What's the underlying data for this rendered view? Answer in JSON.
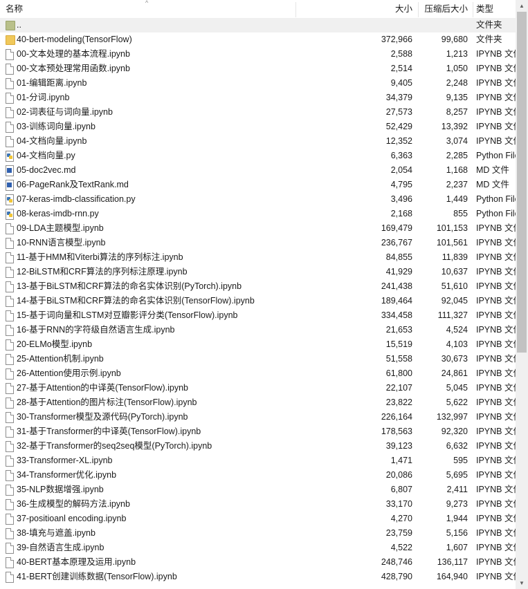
{
  "header": {
    "name_label": "名称",
    "size_label": "大小",
    "compressed_label": "压缩后大小",
    "type_label": "类型",
    "sort_indicator": "^"
  },
  "scrollbar": {
    "up_arrow": "▲",
    "down_arrow": "▼"
  },
  "rows": [
    {
      "name": "..",
      "size": "",
      "compressed": "",
      "type": "文件夹",
      "icon": "folder-up-icon"
    },
    {
      "name": "40-bert-modeling(TensorFlow)",
      "size": "372,966",
      "compressed": "99,680",
      "type": "文件夹",
      "icon": "folder-icon"
    },
    {
      "name": "00-文本处理的基本流程.ipynb",
      "size": "2,588",
      "compressed": "1,213",
      "type": "IPYNB 文件",
      "icon": "file-icon"
    },
    {
      "name": "00-文本预处理常用函数.ipynb",
      "size": "2,514",
      "compressed": "1,050",
      "type": "IPYNB 文件",
      "icon": "file-icon"
    },
    {
      "name": "01-编辑距离.ipynb",
      "size": "9,405",
      "compressed": "2,248",
      "type": "IPYNB 文件",
      "icon": "file-icon"
    },
    {
      "name": "01-分词.ipynb",
      "size": "34,379",
      "compressed": "9,135",
      "type": "IPYNB 文件",
      "icon": "file-icon"
    },
    {
      "name": "02-词表征与词向量.ipynb",
      "size": "27,573",
      "compressed": "8,257",
      "type": "IPYNB 文件",
      "icon": "file-icon"
    },
    {
      "name": "03-训练词向量.ipynb",
      "size": "52,429",
      "compressed": "13,392",
      "type": "IPYNB 文件",
      "icon": "file-icon"
    },
    {
      "name": "04-文档向量.ipynb",
      "size": "12,352",
      "compressed": "3,074",
      "type": "IPYNB 文件",
      "icon": "file-icon"
    },
    {
      "name": "04-文档向量.py",
      "size": "6,363",
      "compressed": "2,285",
      "type": "Python File",
      "icon": "python-file-icon"
    },
    {
      "name": "05-doc2vec.md",
      "size": "2,054",
      "compressed": "1,168",
      "type": "MD 文件",
      "icon": "markdown-file-icon"
    },
    {
      "name": "06-PageRank及TextRank.md",
      "size": "4,795",
      "compressed": "2,237",
      "type": "MD 文件",
      "icon": "markdown-file-icon"
    },
    {
      "name": "07-keras-imdb-classification.py",
      "size": "3,496",
      "compressed": "1,449",
      "type": "Python File",
      "icon": "python-file-icon"
    },
    {
      "name": "08-keras-imdb-rnn.py",
      "size": "2,168",
      "compressed": "855",
      "type": "Python File",
      "icon": "python-file-icon"
    },
    {
      "name": "09-LDA主题模型.ipynb",
      "size": "169,479",
      "compressed": "101,153",
      "type": "IPYNB 文件",
      "icon": "file-icon"
    },
    {
      "name": "10-RNN语言模型.ipynb",
      "size": "236,767",
      "compressed": "101,561",
      "type": "IPYNB 文件",
      "icon": "file-icon"
    },
    {
      "name": "11-基于HMM和Viterbi算法的序列标注.ipynb",
      "size": "84,855",
      "compressed": "11,839",
      "type": "IPYNB 文件",
      "icon": "file-icon"
    },
    {
      "name": "12-BiLSTM和CRF算法的序列标注原理.ipynb",
      "size": "41,929",
      "compressed": "10,637",
      "type": "IPYNB 文件",
      "icon": "file-icon"
    },
    {
      "name": "13-基于BiLSTM和CRF算法的命名实体识别(PyTorch).ipynb",
      "size": "241,438",
      "compressed": "51,610",
      "type": "IPYNB 文件",
      "icon": "file-icon"
    },
    {
      "name": "14-基于BiLSTM和CRF算法的命名实体识别(TensorFlow).ipynb",
      "size": "189,464",
      "compressed": "92,045",
      "type": "IPYNB 文件",
      "icon": "file-icon"
    },
    {
      "name": "15-基于词向量和LSTM对豆瓣影评分类(TensorFlow).ipynb",
      "size": "334,458",
      "compressed": "111,327",
      "type": "IPYNB 文件",
      "icon": "file-icon"
    },
    {
      "name": "16-基于RNN的字符级自然语言生成.ipynb",
      "size": "21,653",
      "compressed": "4,524",
      "type": "IPYNB 文件",
      "icon": "file-icon"
    },
    {
      "name": "20-ELMo模型.ipynb",
      "size": "15,519",
      "compressed": "4,103",
      "type": "IPYNB 文件",
      "icon": "file-icon"
    },
    {
      "name": "25-Attention机制.ipynb",
      "size": "51,558",
      "compressed": "30,673",
      "type": "IPYNB 文件",
      "icon": "file-icon"
    },
    {
      "name": "26-Attention使用示例.ipynb",
      "size": "61,800",
      "compressed": "24,861",
      "type": "IPYNB 文件",
      "icon": "file-icon"
    },
    {
      "name": "27-基于Attention的中译英(TensorFlow).ipynb",
      "size": "22,107",
      "compressed": "5,045",
      "type": "IPYNB 文件",
      "icon": "file-icon"
    },
    {
      "name": "28-基于Attention的图片标注(TensorFlow).ipynb",
      "size": "23,822",
      "compressed": "5,622",
      "type": "IPYNB 文件",
      "icon": "file-icon"
    },
    {
      "name": "30-Transformer模型及源代码(PyTorch).ipynb",
      "size": "226,164",
      "compressed": "132,997",
      "type": "IPYNB 文件",
      "icon": "file-icon"
    },
    {
      "name": "31-基于Transformer的中译英(TensorFlow).ipynb",
      "size": "178,563",
      "compressed": "92,320",
      "type": "IPYNB 文件",
      "icon": "file-icon"
    },
    {
      "name": "32-基于Transformer的seq2seq模型(PyTorch).ipynb",
      "size": "39,123",
      "compressed": "6,632",
      "type": "IPYNB 文件",
      "icon": "file-icon"
    },
    {
      "name": "33-Transformer-XL.ipynb",
      "size": "1,471",
      "compressed": "595",
      "type": "IPYNB 文件",
      "icon": "file-icon"
    },
    {
      "name": "34-Transformer优化.ipynb",
      "size": "20,086",
      "compressed": "5,695",
      "type": "IPYNB 文件",
      "icon": "file-icon"
    },
    {
      "name": "35-NLP数据增强.ipynb",
      "size": "6,807",
      "compressed": "2,411",
      "type": "IPYNB 文件",
      "icon": "file-icon"
    },
    {
      "name": "36-生成模型的解码方法.ipynb",
      "size": "33,170",
      "compressed": "9,273",
      "type": "IPYNB 文件",
      "icon": "file-icon"
    },
    {
      "name": "37-positioanl encoding.ipynb",
      "size": "4,270",
      "compressed": "1,944",
      "type": "IPYNB 文件",
      "icon": "file-icon"
    },
    {
      "name": "38-填充与遮盖.ipynb",
      "size": "23,759",
      "compressed": "5,156",
      "type": "IPYNB 文件",
      "icon": "file-icon"
    },
    {
      "name": "39-自然语言生成.ipynb",
      "size": "4,522",
      "compressed": "1,607",
      "type": "IPYNB 文件",
      "icon": "file-icon"
    },
    {
      "name": "40-BERT基本原理及运用.ipynb",
      "size": "248,746",
      "compressed": "136,117",
      "type": "IPYNB 文件",
      "icon": "file-icon"
    },
    {
      "name": "41-BERT创建训练数据(TensorFlow).ipynb",
      "size": "428,790",
      "compressed": "164,940",
      "type": "IPYNB 文件",
      "icon": "file-icon"
    }
  ]
}
